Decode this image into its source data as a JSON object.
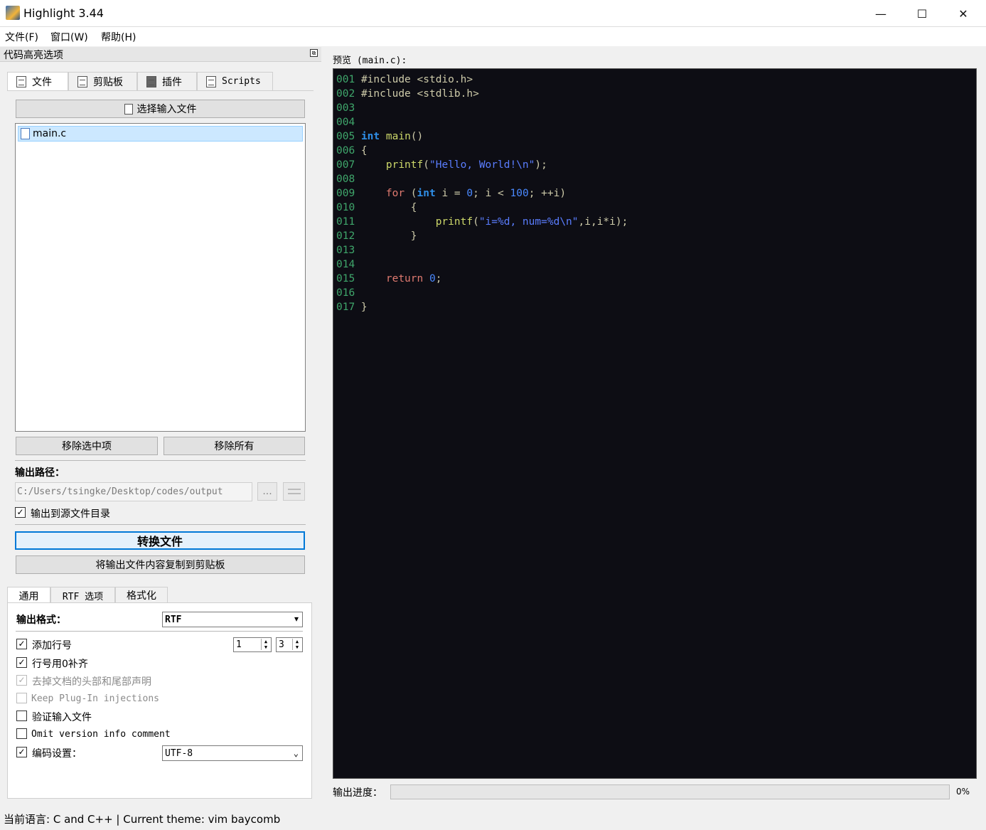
{
  "window": {
    "title": "Highlight 3.44",
    "minimize": "—",
    "maximize": "☐",
    "close": "✕"
  },
  "menu": [
    "文件(F)",
    "窗口(W)",
    "帮助(H)"
  ],
  "dock": {
    "title": "代码高亮选项",
    "tabs": [
      "文件",
      "剪贴板",
      "插件",
      "Scripts"
    ],
    "select_input_button": "选择输入文件",
    "files": [
      "main.c"
    ],
    "remove_selected_button": "移除选中项",
    "remove_all_button": "移除所有",
    "output_path_label": "输出路径：",
    "output_path_value": "C:/Users/tsingke/Desktop/codes/output",
    "browse_button": "...",
    "output_to_source_dir": {
      "label": "输出到源文件目录",
      "checked": true
    },
    "convert_button": "转换文件",
    "copy_to_clipboard_button": "将输出文件内容复制到剪贴板"
  },
  "options": {
    "tabs": [
      "通用",
      "RTF 选项",
      "格式化"
    ],
    "output_format_label": "输出格式：",
    "output_format_value": "RTF",
    "add_line_numbers": {
      "label": "添加行号",
      "checked": true
    },
    "line_number_start": "1",
    "line_number_width": "3",
    "pad_zeros": {
      "label": "行号用0补齐",
      "checked": true
    },
    "strip_header_footer": {
      "label": "去掉文档的头部和尾部声明",
      "checked": true,
      "disabled": true
    },
    "keep_plugin_injections": {
      "label": "Keep Plug-In injections",
      "checked": false,
      "disabled": true
    },
    "validate_input": {
      "label": "验证输入文件",
      "checked": false
    },
    "omit_version": {
      "label": "Omit version info comment",
      "checked": false
    },
    "encoding": {
      "label": "编码设置：",
      "checked": true,
      "value": "UTF-8"
    }
  },
  "preview": {
    "label": "预览 (main.c):",
    "lines": [
      {
        "n": "001",
        "t": "#include <stdio.h>"
      },
      {
        "n": "002",
        "t": "#include <stdlib.h>"
      },
      {
        "n": "003",
        "t": ""
      },
      {
        "n": "004",
        "t": ""
      },
      {
        "n": "005",
        "t": "int main()"
      },
      {
        "n": "006",
        "t": "{"
      },
      {
        "n": "007",
        "t": "    printf(\"Hello, World!\\n\");"
      },
      {
        "n": "008",
        "t": ""
      },
      {
        "n": "009",
        "t": "    for (int i = 0; i < 100; ++i)"
      },
      {
        "n": "010",
        "t": "        {"
      },
      {
        "n": "011",
        "t": "            printf(\"i=%d, num=%d\\n\",i,i*i);"
      },
      {
        "n": "012",
        "t": "        }"
      },
      {
        "n": "013",
        "t": ""
      },
      {
        "n": "014",
        "t": ""
      },
      {
        "n": "015",
        "t": "    return 0;"
      },
      {
        "n": "016",
        "t": ""
      },
      {
        "n": "017",
        "t": "}"
      }
    ]
  },
  "progress": {
    "label": "输出进度：",
    "value": 0,
    "percent_text": "0%"
  },
  "status": "当前语言: C and C++  | Current theme: vim baycomb",
  "colors": {
    "code_bg": "#0d0d14",
    "line_number": "#3fa66b",
    "keyword": "#e07a70",
    "type": "#2f8fe8",
    "function": "#cdd86a",
    "string": "#5a7dff",
    "accent": "#0078d7"
  }
}
